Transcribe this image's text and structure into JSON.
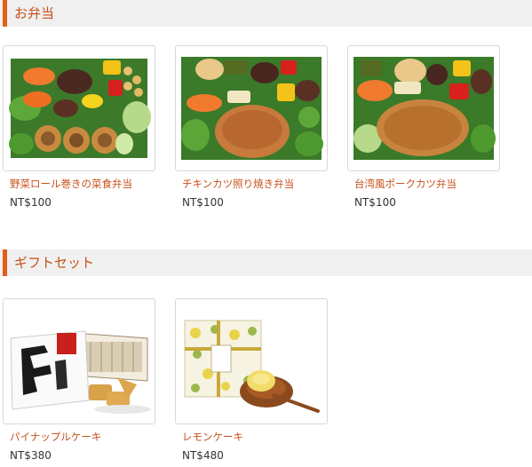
{
  "sections": [
    {
      "title": "お弁当",
      "products": [
        {
          "name": "野菜ロール巻きの菜食弁当",
          "price": "NT$100",
          "image": "bento-veggie-roll"
        },
        {
          "name": "チキンカツ照り焼き弁当",
          "price": "NT$100",
          "image": "bento-chicken-cutlet"
        },
        {
          "name": "台湾風ポークカツ弁当",
          "price": "NT$100",
          "image": "bento-pork-cutlet"
        }
      ]
    },
    {
      "title": "ギフトセット",
      "products": [
        {
          "name": "パイナップルケーキ",
          "price": "NT$380",
          "image": "pineapple-cake-gift-box"
        },
        {
          "name": "レモンケーキ",
          "price": "NT$480",
          "image": "lemon-cake-gift-box"
        }
      ]
    }
  ],
  "colors": {
    "accent": "#e0601a",
    "title_text": "#c8501a",
    "header_bg": "#f0f0f0",
    "price_text": "#333333"
  }
}
